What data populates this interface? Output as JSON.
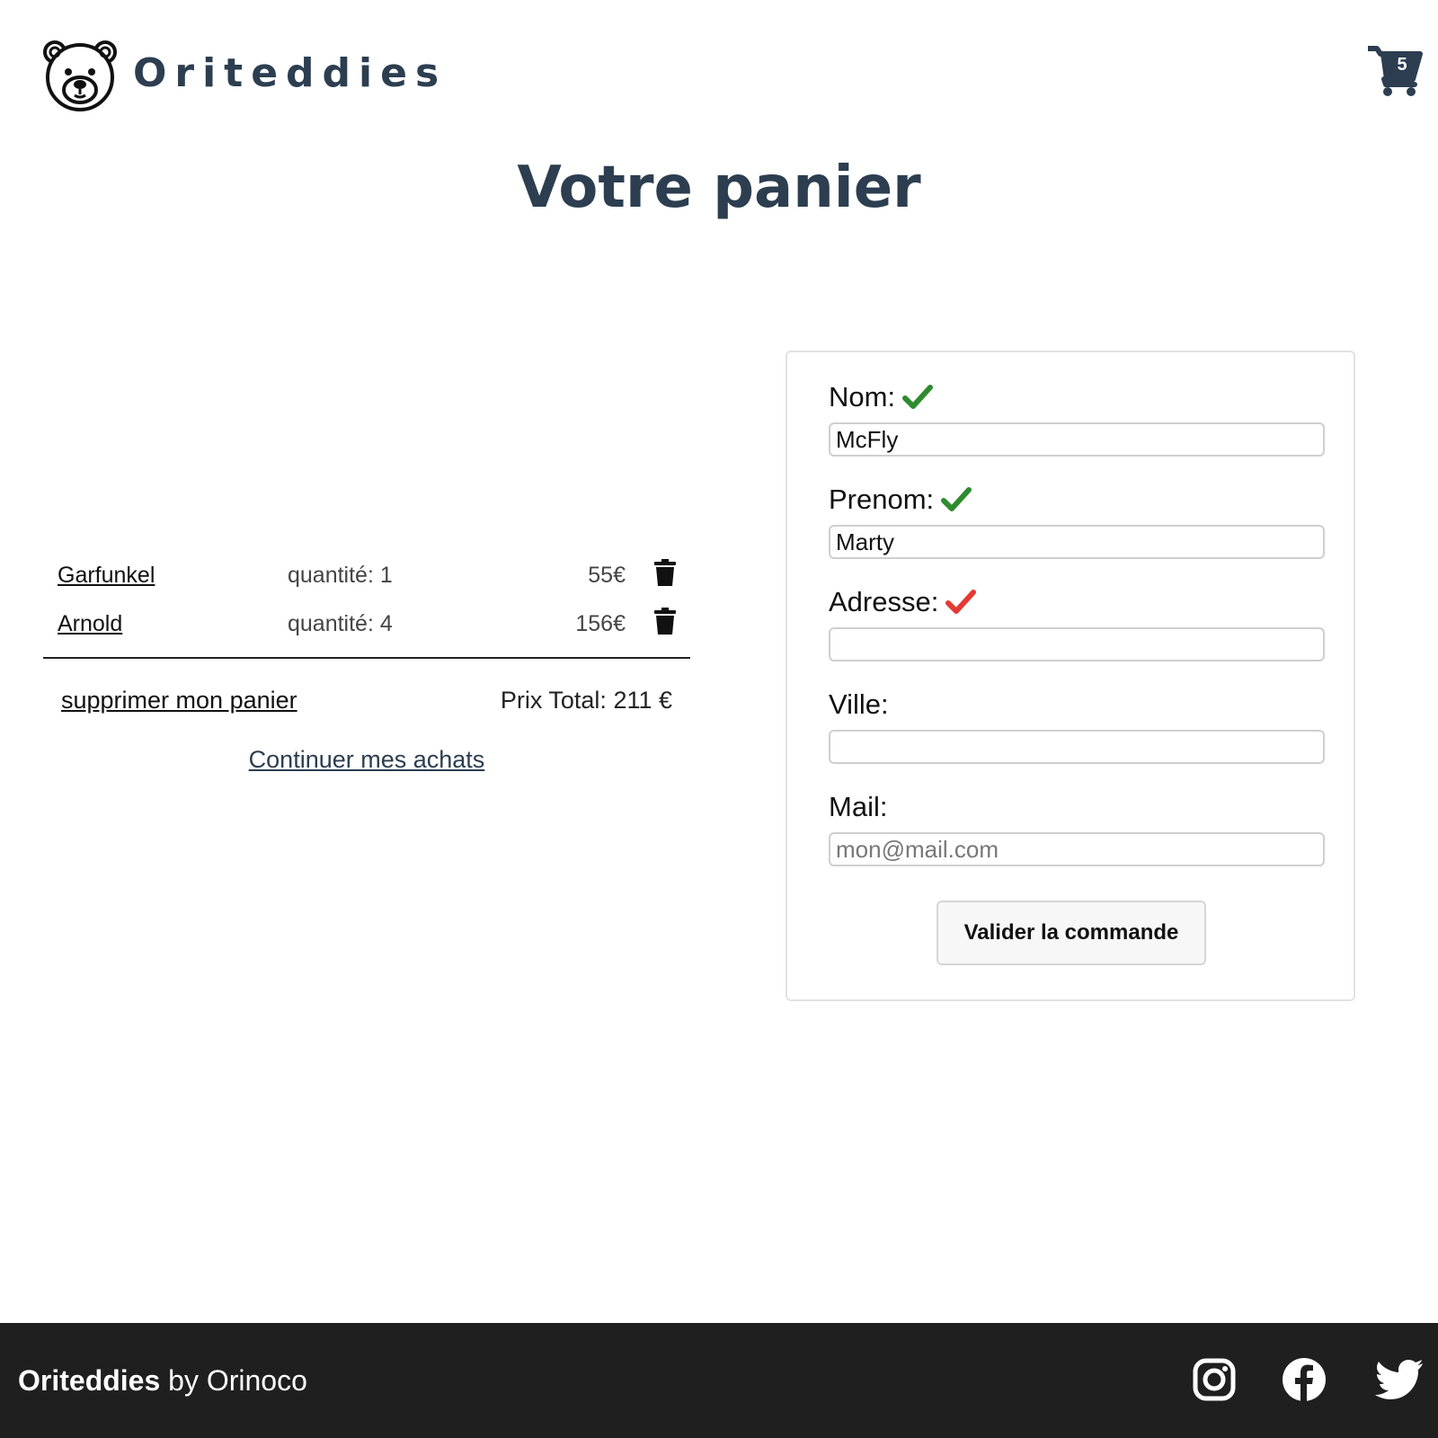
{
  "header": {
    "brand": "Oriteddies",
    "cart_count": "5"
  },
  "page_title": "Votre panier",
  "cart": {
    "items": [
      {
        "name": "Garfunkel",
        "quantity": "quantité: 1",
        "price": "55€"
      },
      {
        "name": "Arnold",
        "quantity": "quantité: 4",
        "price": "156€"
      }
    ],
    "clear_label": "supprimer mon panier",
    "total": "Prix Total: 211 €",
    "continue_label": "Continuer mes achats"
  },
  "form": {
    "nom": {
      "label": "Nom:",
      "value": "McFly",
      "status": "valid"
    },
    "prenom": {
      "label": "Prenom:",
      "value": "Marty",
      "status": "valid"
    },
    "adresse": {
      "label": "Adresse:",
      "value": "",
      "status": "invalid"
    },
    "ville": {
      "label": "Ville:",
      "value": ""
    },
    "mail": {
      "label": "Mail:",
      "value": "",
      "placeholder": "mon@mail.com"
    },
    "submit_label": "Valider la commande"
  },
  "footer": {
    "brand": "Oriteddies",
    "suffix": " by Orinoco",
    "icons": [
      "instagram-icon",
      "facebook-icon",
      "twitter-icon"
    ]
  },
  "colors": {
    "primary": "#2c3e50",
    "valid": "#2e8b2e",
    "invalid": "#e53935",
    "footer_bg": "#1f1f1f"
  }
}
